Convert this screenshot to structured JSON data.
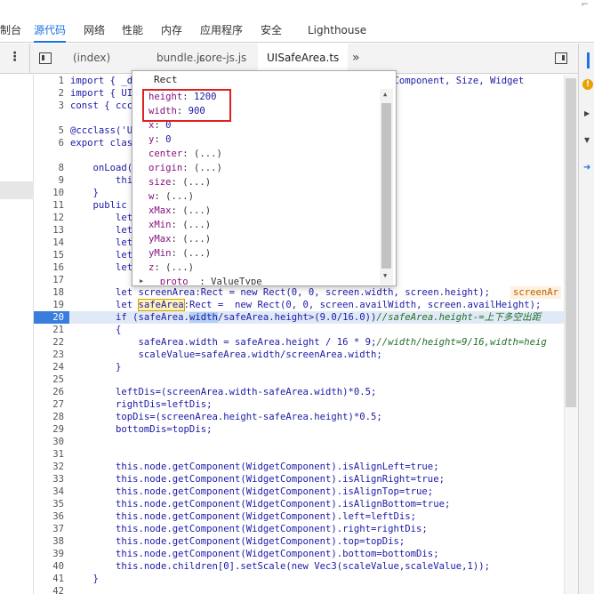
{
  "top_tabs": [
    "制台",
    "源代码",
    "网络",
    "性能",
    "内存",
    "应用程序",
    "安全",
    "Lighthouse"
  ],
  "active_top_tab": "源代码",
  "file_tabs": [
    "(index)",
    "bundle.js",
    "core-js.js",
    "UISafeArea.ts"
  ],
  "active_file_tab": "UISafeArea.ts",
  "more_label": "⋮",
  "overflow_label": "»",
  "warning_symbol": "!",
  "popover": {
    "title": "Rect",
    "props": [
      {
        "key": "height",
        "sep": ": ",
        "val": "1200",
        "plain": false
      },
      {
        "key": "width",
        "sep": ": ",
        "val": "900",
        "plain": false
      },
      {
        "key": "x",
        "sep": ": ",
        "val": "0",
        "plain": false
      },
      {
        "key": "y",
        "sep": ": ",
        "val": "0",
        "plain": false
      },
      {
        "key": "center",
        "sep": ": ",
        "val": "(...)",
        "plain": true
      },
      {
        "key": "origin",
        "sep": ": ",
        "val": "(...)",
        "plain": true
      },
      {
        "key": "size",
        "sep": ": ",
        "val": "(...)",
        "plain": true
      },
      {
        "key": "w",
        "sep": ": ",
        "val": "(...)",
        "plain": true
      },
      {
        "key": "xMax",
        "sep": ": ",
        "val": "(...)",
        "plain": true
      },
      {
        "key": "xMin",
        "sep": ": ",
        "val": "(...)",
        "plain": true
      },
      {
        "key": "yMax",
        "sep": ": ",
        "val": "(...)",
        "plain": true
      },
      {
        "key": "yMin",
        "sep": ": ",
        "val": "(...)",
        "plain": true
      },
      {
        "key": "z",
        "sep": ": ",
        "val": "(...)",
        "plain": true
      },
      {
        "key": "__proto__",
        "sep": ": ",
        "val": "ValueType",
        "plain": true
      }
    ]
  },
  "code_lines": [
    {
      "n": "1",
      "text": "import { _dec...                                    sformComponent, Size, Widget"
    },
    {
      "n": "2",
      "text": "import { UI"
    },
    {
      "n": "3",
      "text": "const { ccc"
    },
    {
      "n": "",
      "text": ""
    },
    {
      "n": "5",
      "text": "@ccclass('U"
    },
    {
      "n": "6",
      "text": "export clas"
    },
    {
      "n": "",
      "text": ""
    },
    {
      "n": "8",
      "text": "    onLoad("
    },
    {
      "n": "9",
      "text": "        thi"
    },
    {
      "n": "10",
      "text": "    }"
    },
    {
      "n": "11",
      "text": "    public"
    },
    {
      "n": "12",
      "text": "        let"
    },
    {
      "n": "13",
      "text": "        let"
    },
    {
      "n": "14",
      "text": "        let"
    },
    {
      "n": "15",
      "text": "        let"
    },
    {
      "n": "16",
      "text": "        let"
    },
    {
      "n": "17",
      "text": ""
    },
    {
      "n": "18",
      "text": "        let screenArea:Rect = new Rect(0, 0, screen.width, screen.height);"
    },
    {
      "n": "19",
      "text": ""
    },
    {
      "n": "20",
      "text": ""
    },
    {
      "n": "21",
      "text": "        {"
    },
    {
      "n": "22",
      "text": "            safeArea.width = safeArea.height / 16 * 9;"
    },
    {
      "n": "23",
      "text": "            scaleValue=safeArea.width/screenArea.width;"
    },
    {
      "n": "24",
      "text": "        }"
    },
    {
      "n": "25",
      "text": ""
    },
    {
      "n": "26",
      "text": "        leftDis=(screenArea.width-safeArea.width)*0.5;"
    },
    {
      "n": "27",
      "text": "        rightDis=leftDis;"
    },
    {
      "n": "28",
      "text": "        topDis=(screenArea.height-safeArea.height)*0.5;"
    },
    {
      "n": "29",
      "text": "        bottomDis=topDis;"
    },
    {
      "n": "30",
      "text": ""
    },
    {
      "n": "31",
      "text": ""
    },
    {
      "n": "32",
      "text": "        this.node.getComponent(WidgetComponent).isAlignLeft=true;"
    },
    {
      "n": "33",
      "text": "        this.node.getComponent(WidgetComponent).isAlignRight=true;"
    },
    {
      "n": "34",
      "text": "        this.node.getComponent(WidgetComponent).isAlignTop=true;"
    },
    {
      "n": "35",
      "text": "        this.node.getComponent(WidgetComponent).isAlignBottom=true;"
    },
    {
      "n": "36",
      "text": "        this.node.getComponent(WidgetComponent).left=leftDis;"
    },
    {
      "n": "37",
      "text": "        this.node.getComponent(WidgetComponent).right=rightDis;"
    },
    {
      "n": "38",
      "text": "        this.node.getComponent(WidgetComponent).top=topDis;"
    },
    {
      "n": "39",
      "text": "        this.node.getComponent(WidgetComponent).bottom=bottomDis;"
    },
    {
      "n": "40",
      "text": "        this.node.children[0].setScale(new Vec3(scaleValue,scaleValue,1));"
    },
    {
      "n": "41",
      "text": "    }"
    },
    {
      "n": "42",
      "text": ""
    }
  ],
  "line18_inline": "screenAr",
  "line19": {
    "pre": "        let ",
    "word": "safeArea",
    "post": ":Rect =  new Rect(0, 0, screen.availWidth, screen.availHeight);"
  },
  "line20": {
    "pre": "        if (safeArea.",
    "word": "width",
    "mid": "/safeArea.height>(9.0/16.0))",
    "comment": "//safeArea.height-=上下多空出距"
  },
  "line22_comment": "//width/height=9/16,width=heig"
}
